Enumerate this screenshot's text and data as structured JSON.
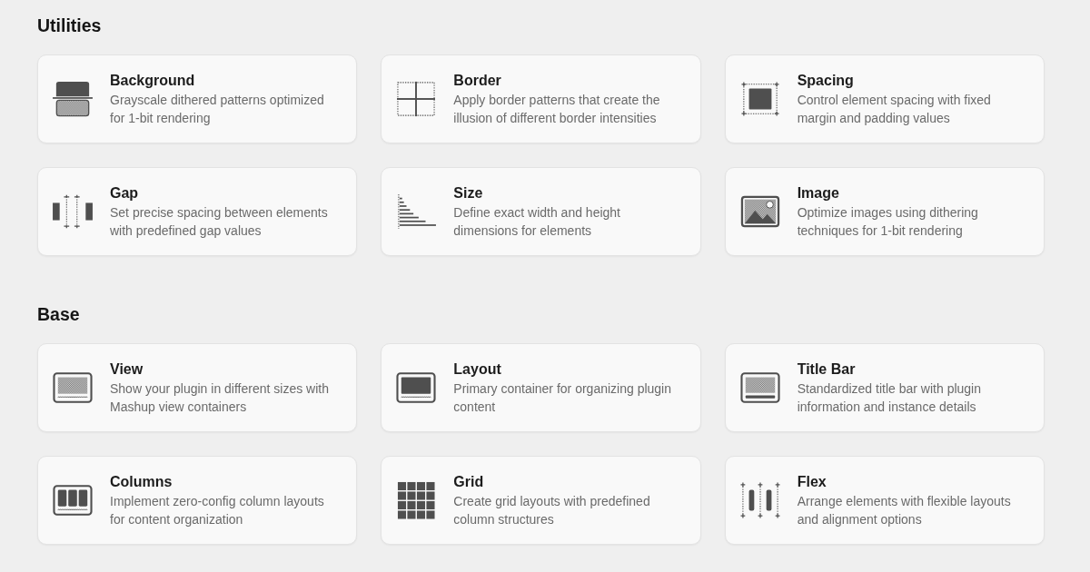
{
  "sections": [
    {
      "title": "Utilities",
      "cards": [
        {
          "kind": "background",
          "title": "Background",
          "description": "Grayscale dithered patterns optimized for 1-bit rendering"
        },
        {
          "kind": "border",
          "title": "Border",
          "description": "Apply border patterns that create the illusion of different border intensities"
        },
        {
          "kind": "spacing",
          "title": "Spacing",
          "description": "Control element spacing with fixed margin and padding values"
        },
        {
          "kind": "gap",
          "title": "Gap",
          "description": "Set precise spacing between elements with predefined gap values"
        },
        {
          "kind": "size",
          "title": "Size",
          "description": "Define exact width and height dimensions for elements"
        },
        {
          "kind": "image",
          "title": "Image",
          "description": "Optimize images using dithering techniques for 1-bit rendering"
        }
      ]
    },
    {
      "title": "Base",
      "cards": [
        {
          "kind": "view",
          "title": "View",
          "description": "Show your plugin in different sizes with Mashup view containers"
        },
        {
          "kind": "layout",
          "title": "Layout",
          "description": "Primary container for organizing plugin content"
        },
        {
          "kind": "titlebar",
          "title": "Title Bar",
          "description": "Standardized title bar with plugin information and instance details"
        },
        {
          "kind": "columns",
          "title": "Columns",
          "description": "Implement zero-config column layouts for content organization"
        },
        {
          "kind": "grid",
          "title": "Grid",
          "description": "Create grid layouts with predefined column structures"
        },
        {
          "kind": "flex",
          "title": "Flex",
          "description": "Arrange elements with flexible layouts and alignment options"
        }
      ]
    }
  ]
}
